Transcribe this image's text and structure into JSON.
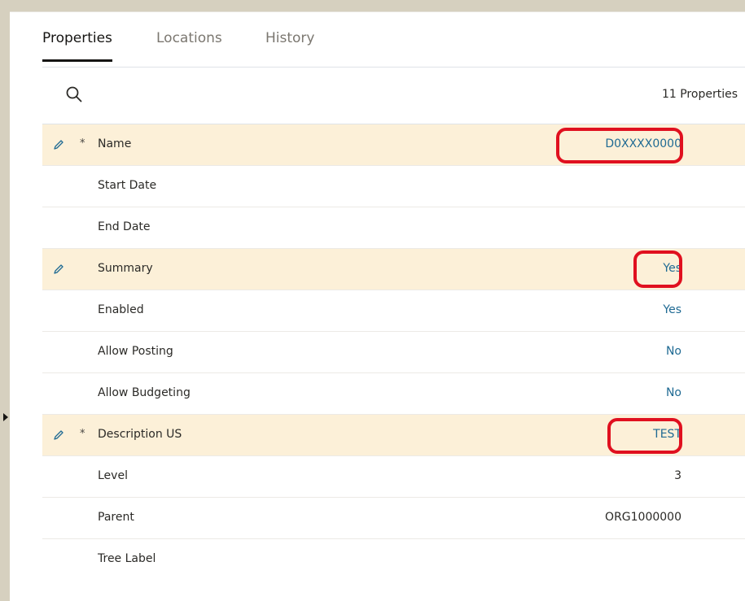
{
  "tabs": [
    {
      "label": "Properties",
      "active": true
    },
    {
      "label": "Locations",
      "active": false
    },
    {
      "label": "History",
      "active": false
    }
  ],
  "search": {
    "icon": "search-icon",
    "count_label": "11 Properties"
  },
  "properties": [
    {
      "label": "Name",
      "required": "*",
      "value": "D0XXXX0000",
      "modified": true
    },
    {
      "label": "Start Date",
      "value": ""
    },
    {
      "label": "End Date",
      "value": ""
    },
    {
      "label": "Summary",
      "value": "Yes",
      "modified": true
    },
    {
      "label": "Enabled",
      "value": "Yes"
    },
    {
      "label": "Allow Posting",
      "value": "No"
    },
    {
      "label": "Allow Budgeting",
      "value": "No"
    },
    {
      "label": "Description US",
      "required": "*",
      "value": "TEST",
      "modified": true
    },
    {
      "label": "Level",
      "value": "3"
    },
    {
      "label": "Parent",
      "value": "ORG1000000"
    },
    {
      "label": "Tree Label",
      "value": ""
    }
  ],
  "colors": {
    "accent_link": "#1f6a93",
    "modified_row": "#fcf0d8",
    "highlight_circle": "#e0101f"
  }
}
